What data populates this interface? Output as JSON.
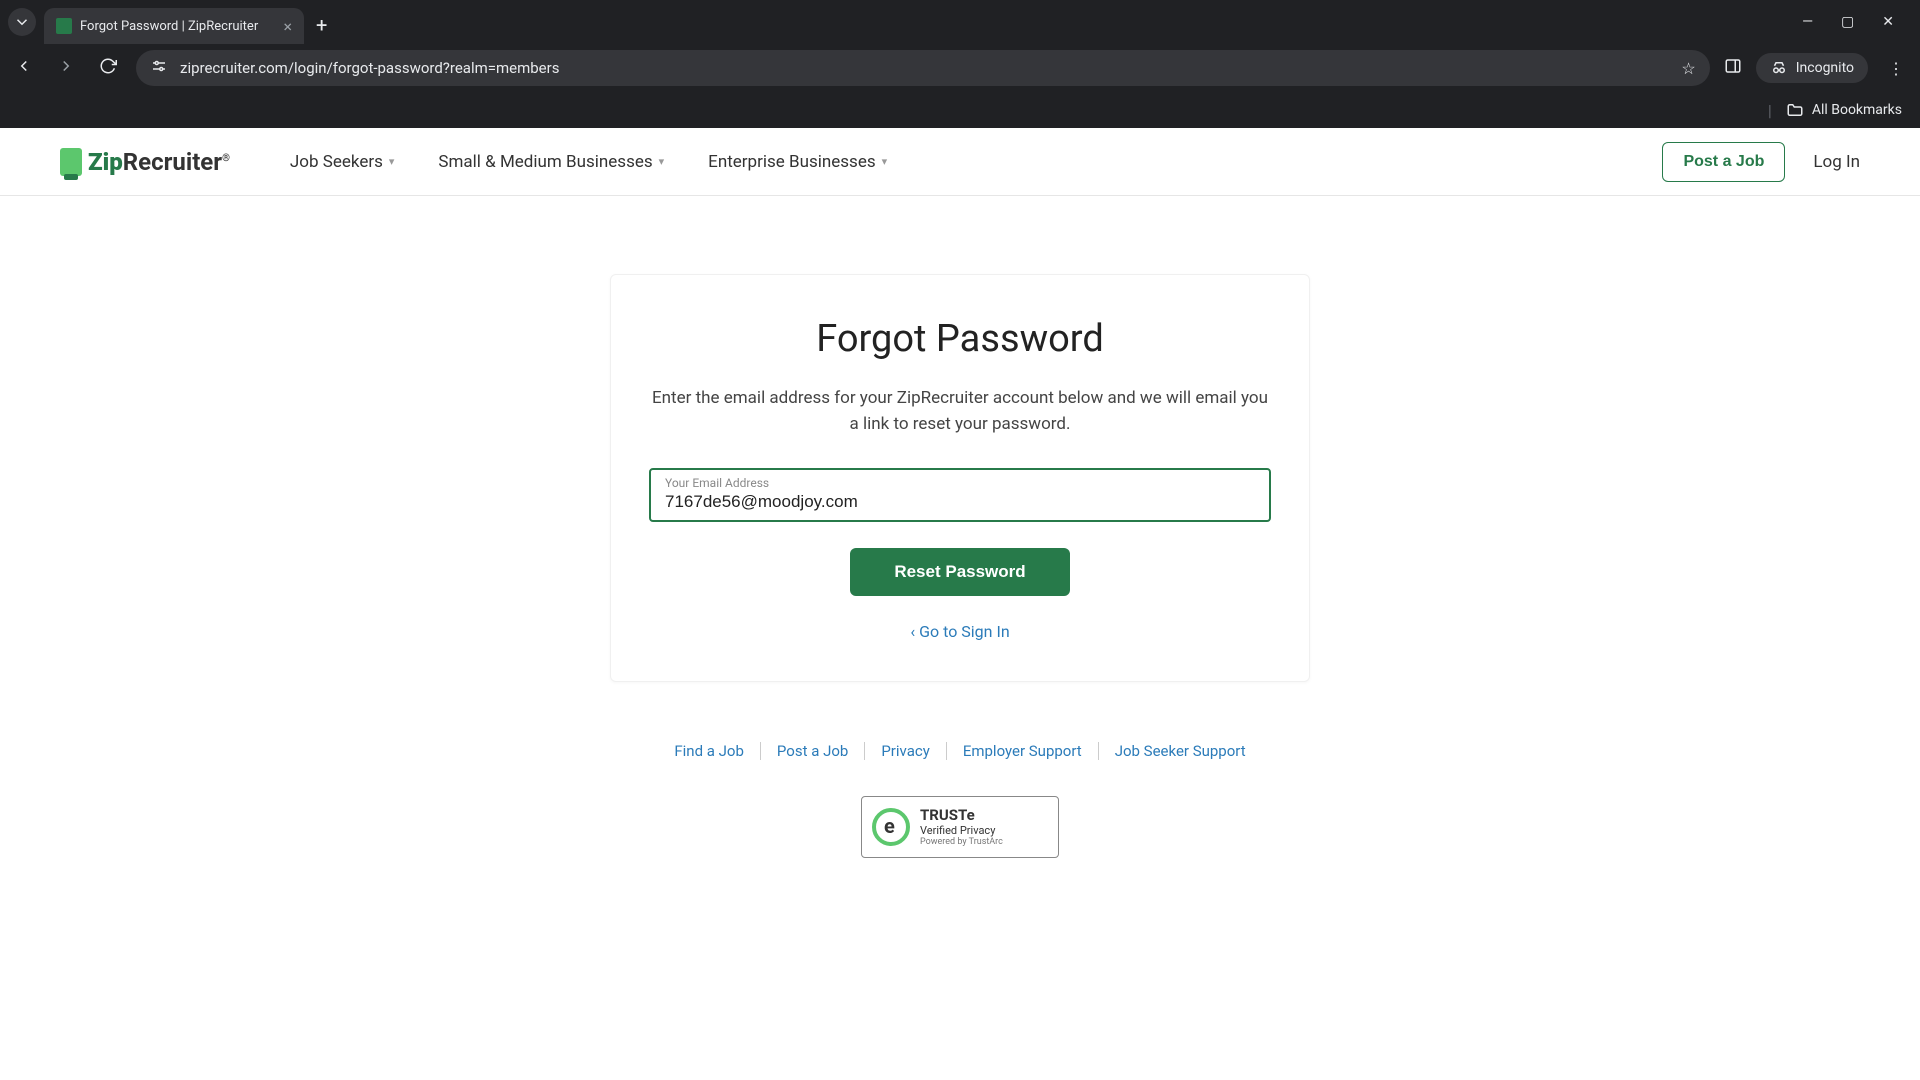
{
  "browser": {
    "tab_title": "Forgot Password | ZipRecruiter",
    "url": "ziprecruiter.com/login/forgot-password?realm=members",
    "incognito_label": "Incognito",
    "all_bookmarks": "All Bookmarks"
  },
  "header": {
    "logo_text_prefix": "Zip",
    "logo_text_suffix": "Recruiter",
    "nav": {
      "job_seekers": "Job Seekers",
      "smb": "Small & Medium Businesses",
      "enterprise": "Enterprise Businesses"
    },
    "post_a_job": "Post a Job",
    "log_in": "Log In"
  },
  "card": {
    "title": "Forgot Password",
    "desc": "Enter the email address for your ZipRecruiter account below and we will email you a link to reset your password.",
    "email_label": "Your Email Address",
    "email_value": "7167de56@moodjoy.com",
    "reset_button": "Reset Password",
    "signin_link": "‹ Go to Sign In"
  },
  "footer": {
    "links": [
      "Find a Job",
      "Post a Job",
      "Privacy",
      "Employer Support",
      "Job Seeker Support"
    ]
  },
  "truste": {
    "line1": "TRUSTe",
    "line2": "Verified Privacy",
    "line3": "Powered by TrustArc"
  }
}
